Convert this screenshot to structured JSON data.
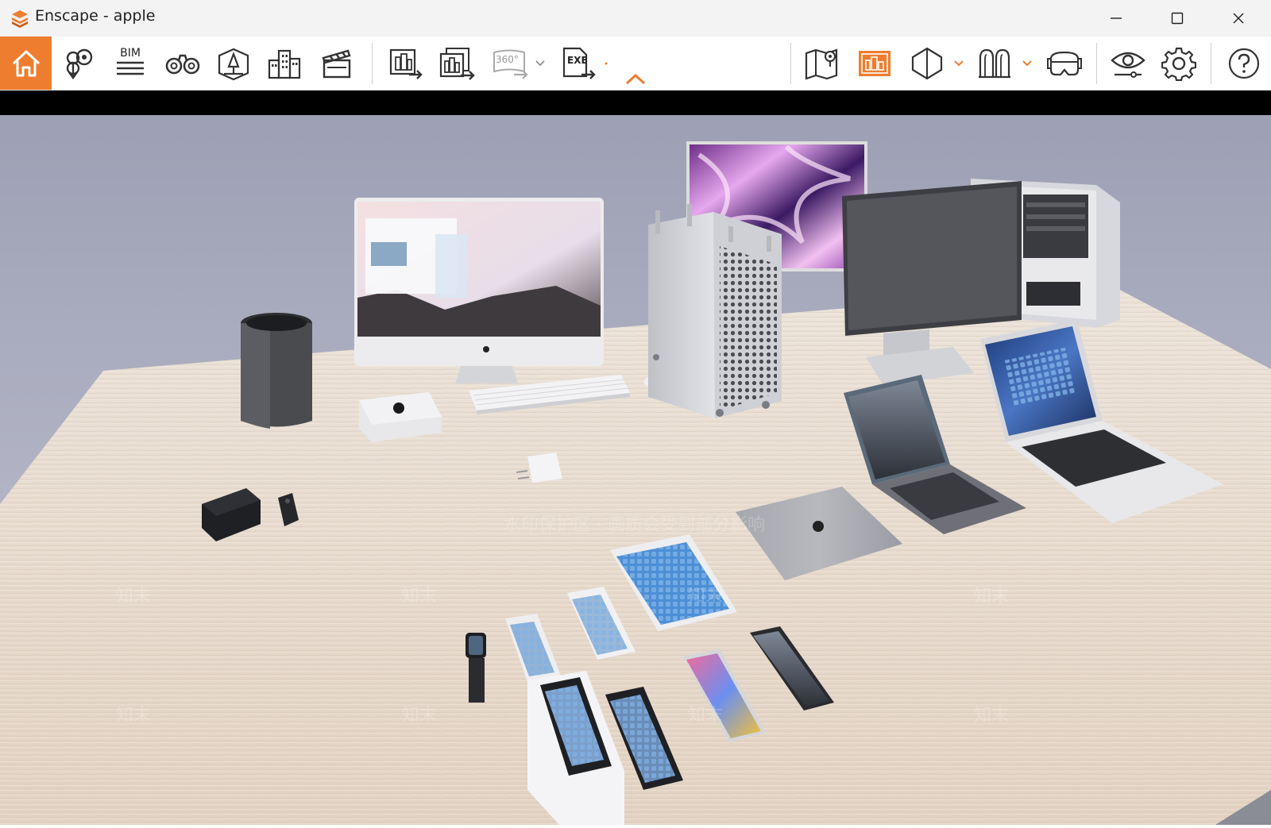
{
  "window": {
    "title": "Enscape - apple",
    "minimize_icon": "minimize-icon",
    "maximize_icon": "maximize-icon",
    "close_icon": "close-icon"
  },
  "toolbar": {
    "accent": "#ee7d2f",
    "bim_label": "BIM",
    "panorama_label": "360°",
    "exe_label": "EXE",
    "left_icons": [
      "home-icon",
      "views-icon",
      "bim-icon",
      "binoculars-icon",
      "perspective-icon",
      "buildings-icon",
      "clapperboard-icon"
    ],
    "export_icons": [
      "screenshot-export-icon",
      "batch-render-export-icon",
      "panorama-export-icon",
      "exe-export-icon",
      "collapse-chevron-icon"
    ],
    "right_icons": [
      "map-icon",
      "asset-library-icon",
      "section-cube-icon",
      "material-icon",
      "vr-headset-icon",
      "visibility-icon",
      "settings-icon",
      "help-icon"
    ]
  },
  "viewport": {
    "description_hidden": "",
    "watermark": "水印保护区 · 画质会受到部分影响",
    "watermark_logo": "知末"
  }
}
